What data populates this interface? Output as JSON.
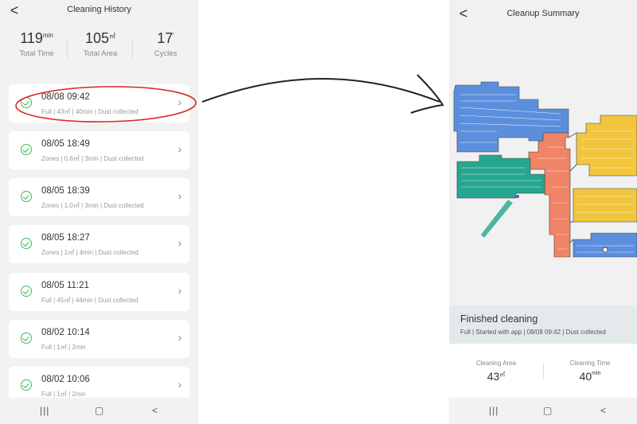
{
  "left": {
    "title": "Cleaning History",
    "back": "<",
    "stats": [
      {
        "value": "119",
        "unit": "min",
        "label": "Total Time"
      },
      {
        "value": "105",
        "unit": "㎡",
        "label": "Total Area"
      },
      {
        "value": "17",
        "unit": "'",
        "label": "Cycles"
      }
    ],
    "records": [
      {
        "datetime": "08/08 09:42",
        "meta": "Full | 43㎡ | 40min | Dust collected"
      },
      {
        "datetime": "08/05 18:49",
        "meta": "Zones | 0.6㎡ | 3min | Dust collected"
      },
      {
        "datetime": "08/05 18:39",
        "meta": "Zones | 1.0㎡ | 3min | Dust collected"
      },
      {
        "datetime": "08/05 18:27",
        "meta": "Zones | 1㎡ | 4min | Dust collected"
      },
      {
        "datetime": "08/05 11:21",
        "meta": "Full | 45㎡ | 44min | Dust collected"
      },
      {
        "datetime": "08/02 10:14",
        "meta": "Full | 1㎡ | 2min"
      },
      {
        "datetime": "08/02 10:06",
        "meta": "Full | 1㎡ | 2min"
      }
    ],
    "nav": {
      "recents": "|||",
      "home": "▢",
      "back": "<"
    }
  },
  "right": {
    "title": "Cleanup Summary",
    "back": "<",
    "summary_title": "Finished cleaning",
    "summary_meta": "Full | Started with app | 08/08 09:42 | Dust collected",
    "area_label": "Cleaning Area",
    "area_value": "43",
    "area_unit": "㎡",
    "time_label": "Cleaning Time",
    "time_value": "40",
    "time_unit": "min",
    "nav": {
      "recents": "|||",
      "home": "▢",
      "back": "<"
    }
  },
  "colors": {
    "room_blue": "#5b8fde",
    "room_yellow": "#f2c53d",
    "room_teal": "#26a58f",
    "room_salmon": "#ef8466",
    "check_green": "#3cba5a",
    "highlight_red": "#d9302b"
  }
}
